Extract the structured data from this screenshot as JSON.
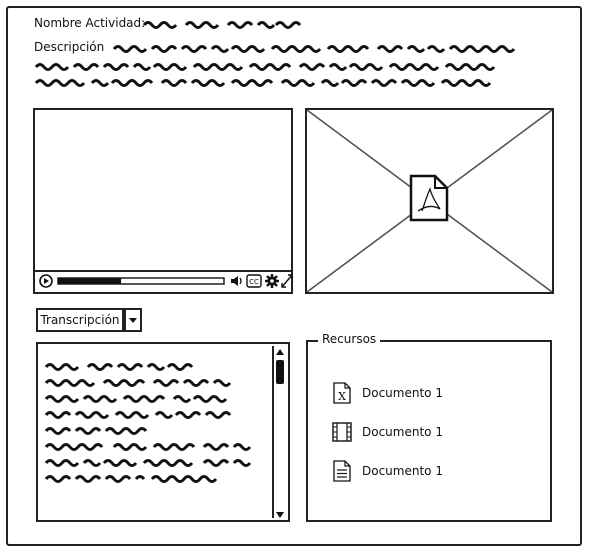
{
  "activity": {
    "name_label": "Nombre Actividad:",
    "description_label": "Descripción"
  },
  "video_player": {
    "progress": 0.38,
    "icons": [
      "play-icon",
      "volume-icon",
      "cc-icon",
      "settings-icon",
      "fullscreen-icon"
    ]
  },
  "image_placeholder": {
    "icon": "pdf-file-icon"
  },
  "transcript": {
    "dropdown_label": "Transcripción"
  },
  "resources": {
    "title": "Recursos",
    "items": [
      {
        "label": "Documento 1",
        "icon": "excel-file-icon"
      },
      {
        "label": "Documento 1",
        "icon": "video-file-icon"
      },
      {
        "label": "Documento 1",
        "icon": "text-file-icon"
      }
    ]
  }
}
